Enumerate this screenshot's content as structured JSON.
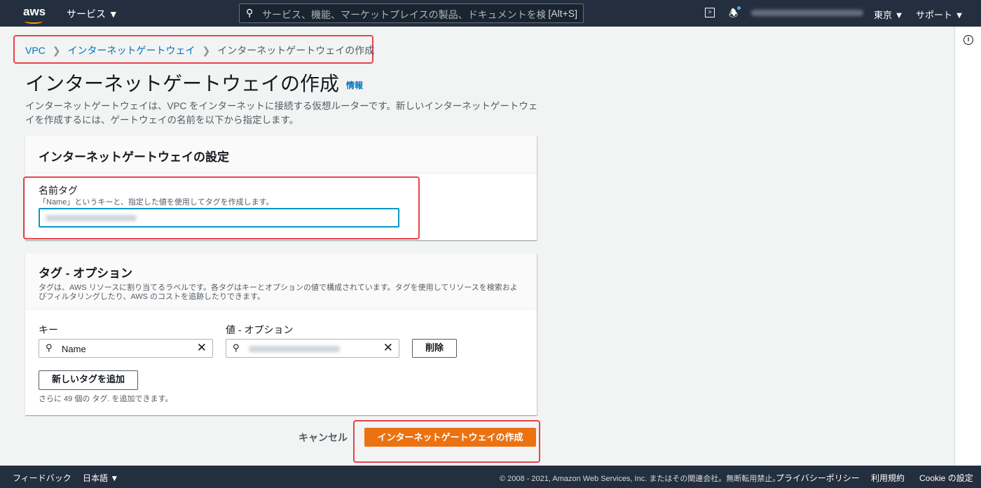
{
  "header": {
    "logo": "aws",
    "services": "サービス ▼",
    "search_placeholder": "サービス、機能、マーケットプレイスの製品、ドキュメントを検索しま",
    "search_shortcut": "[Alt+S]",
    "region": "東京 ▼",
    "support": "サポート ▼",
    "icons": [
      "cloudshell-icon",
      "bell-icon"
    ]
  },
  "breadcrumb": [
    "VPC",
    "インターネットゲートウェイ",
    "インターネットゲートウェイの作成"
  ],
  "page": {
    "title": "インターネットゲートウェイの作成",
    "info": "情報",
    "description": "インターネットゲートウェイは、VPC をインターネットに接続する仮想ルーターです。新しいインターネットゲートウェイを作成するには、ゲートウェイの名前を以下から指定します。"
  },
  "settings": {
    "title": "インターネットゲートウェイの設定",
    "name_label": "名前タグ",
    "name_hint": "「Name」というキーと、指定した値を使用してタグを作成します。",
    "name_value": ""
  },
  "tags": {
    "title": "タグ - オプション",
    "description": "タグは、AWS リソースに割り当てるラベルです。各タグはキーとオプションの値で構成されています。タグを使用してリソースを検索およびフィルタリングしたり、AWS のコストを追跡したりできます。",
    "key_label": "キー",
    "value_label": "値 - オプション",
    "key_value": "Name",
    "value_value": "",
    "remove": "削除",
    "add": "新しいタグを追加",
    "remaining": "さらに 49 個の タグ. を追加できます。"
  },
  "actions": {
    "cancel": "キャンセル",
    "create": "インターネットゲートウェイの作成"
  },
  "footer": {
    "feedback": "フィードバック",
    "language": "日本語 ▼",
    "copyright": "© 2008 - 2021, Amazon Web Services, Inc. またはその関連会社。無断転用禁止。",
    "privacy": "プライバシーポリシー",
    "terms": "利用規約",
    "cookie": "Cookie の設定"
  },
  "colors": {
    "primary": "#ec7211",
    "link": "#0073bb",
    "header": "#232f3e",
    "highlight": "#e8424a"
  }
}
